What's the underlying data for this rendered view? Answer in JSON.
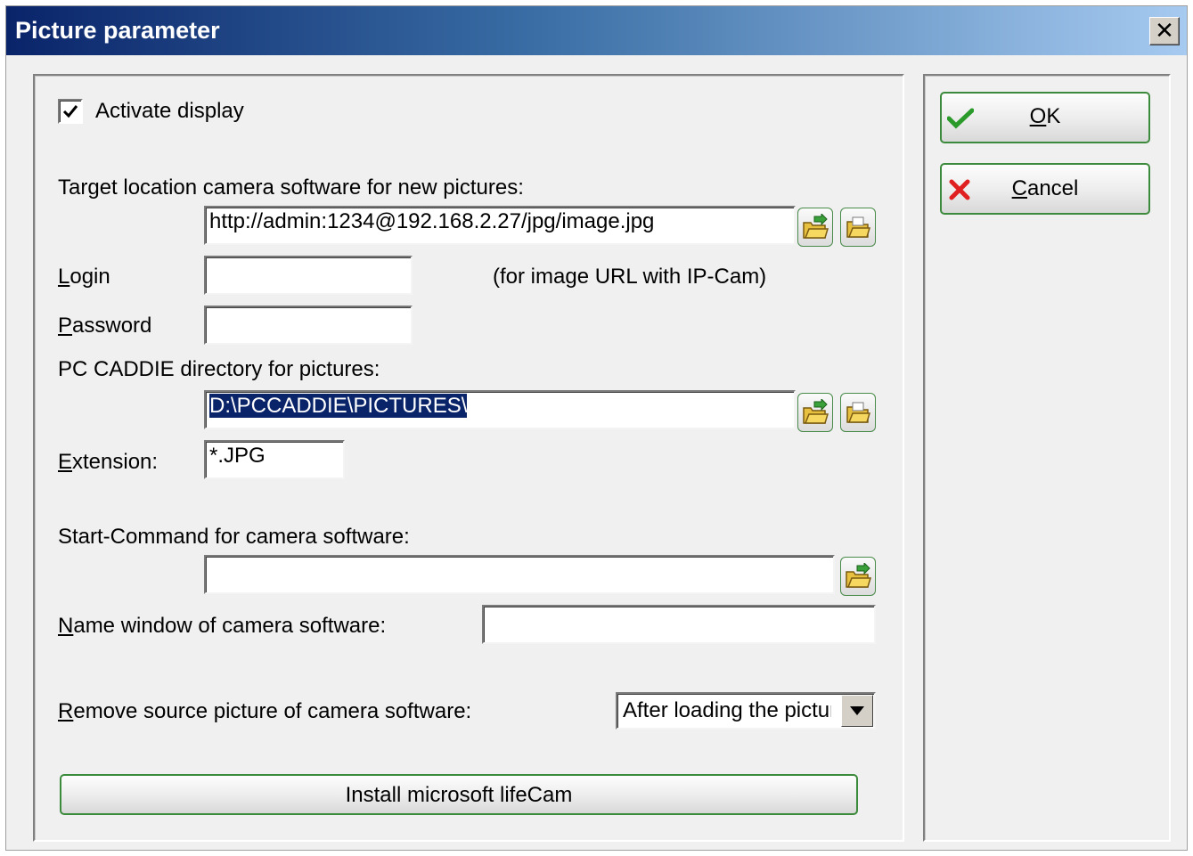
{
  "window": {
    "title": "Picture parameter",
    "close_glyph": "✕"
  },
  "activate": {
    "label": "Activate display",
    "checked": true
  },
  "target": {
    "label": "Target location camera software for new pictures:",
    "value": "http://admin:1234@192.168.2.27/jpg/image.jpg"
  },
  "login": {
    "label_u": "L",
    "label_rest": "ogin",
    "value": "",
    "hint": "(for image URL with IP-Cam)"
  },
  "password": {
    "label_u": "P",
    "label_rest": "assword",
    "value": ""
  },
  "pc_dir": {
    "label": "PC CADDIE directory for pictures:",
    "value": "D:\\PCCADDIE\\PICTURES\\"
  },
  "extension": {
    "label_u": "E",
    "label_rest": "xtension:",
    "value": "*.JPG"
  },
  "start_cmd": {
    "label": "Start-Command for camera software:",
    "value": ""
  },
  "name_window": {
    "label_u": "N",
    "label_rest": "ame window of camera software:",
    "value": ""
  },
  "remove_source": {
    "label_u": "R",
    "label_rest": "emove source picture of camera software:",
    "selected": "After loading the picture"
  },
  "install": {
    "label": "Install microsoft lifeCam"
  },
  "ok": {
    "label_u": "O",
    "label_rest": "K"
  },
  "cancel": {
    "label_u": "C",
    "label_rest": "ancel"
  },
  "colors": {
    "accent_green": "#3c8a3c",
    "title_dark": "#0a246a",
    "title_light": "#a6caf0",
    "cancel_red": "#e02020"
  }
}
